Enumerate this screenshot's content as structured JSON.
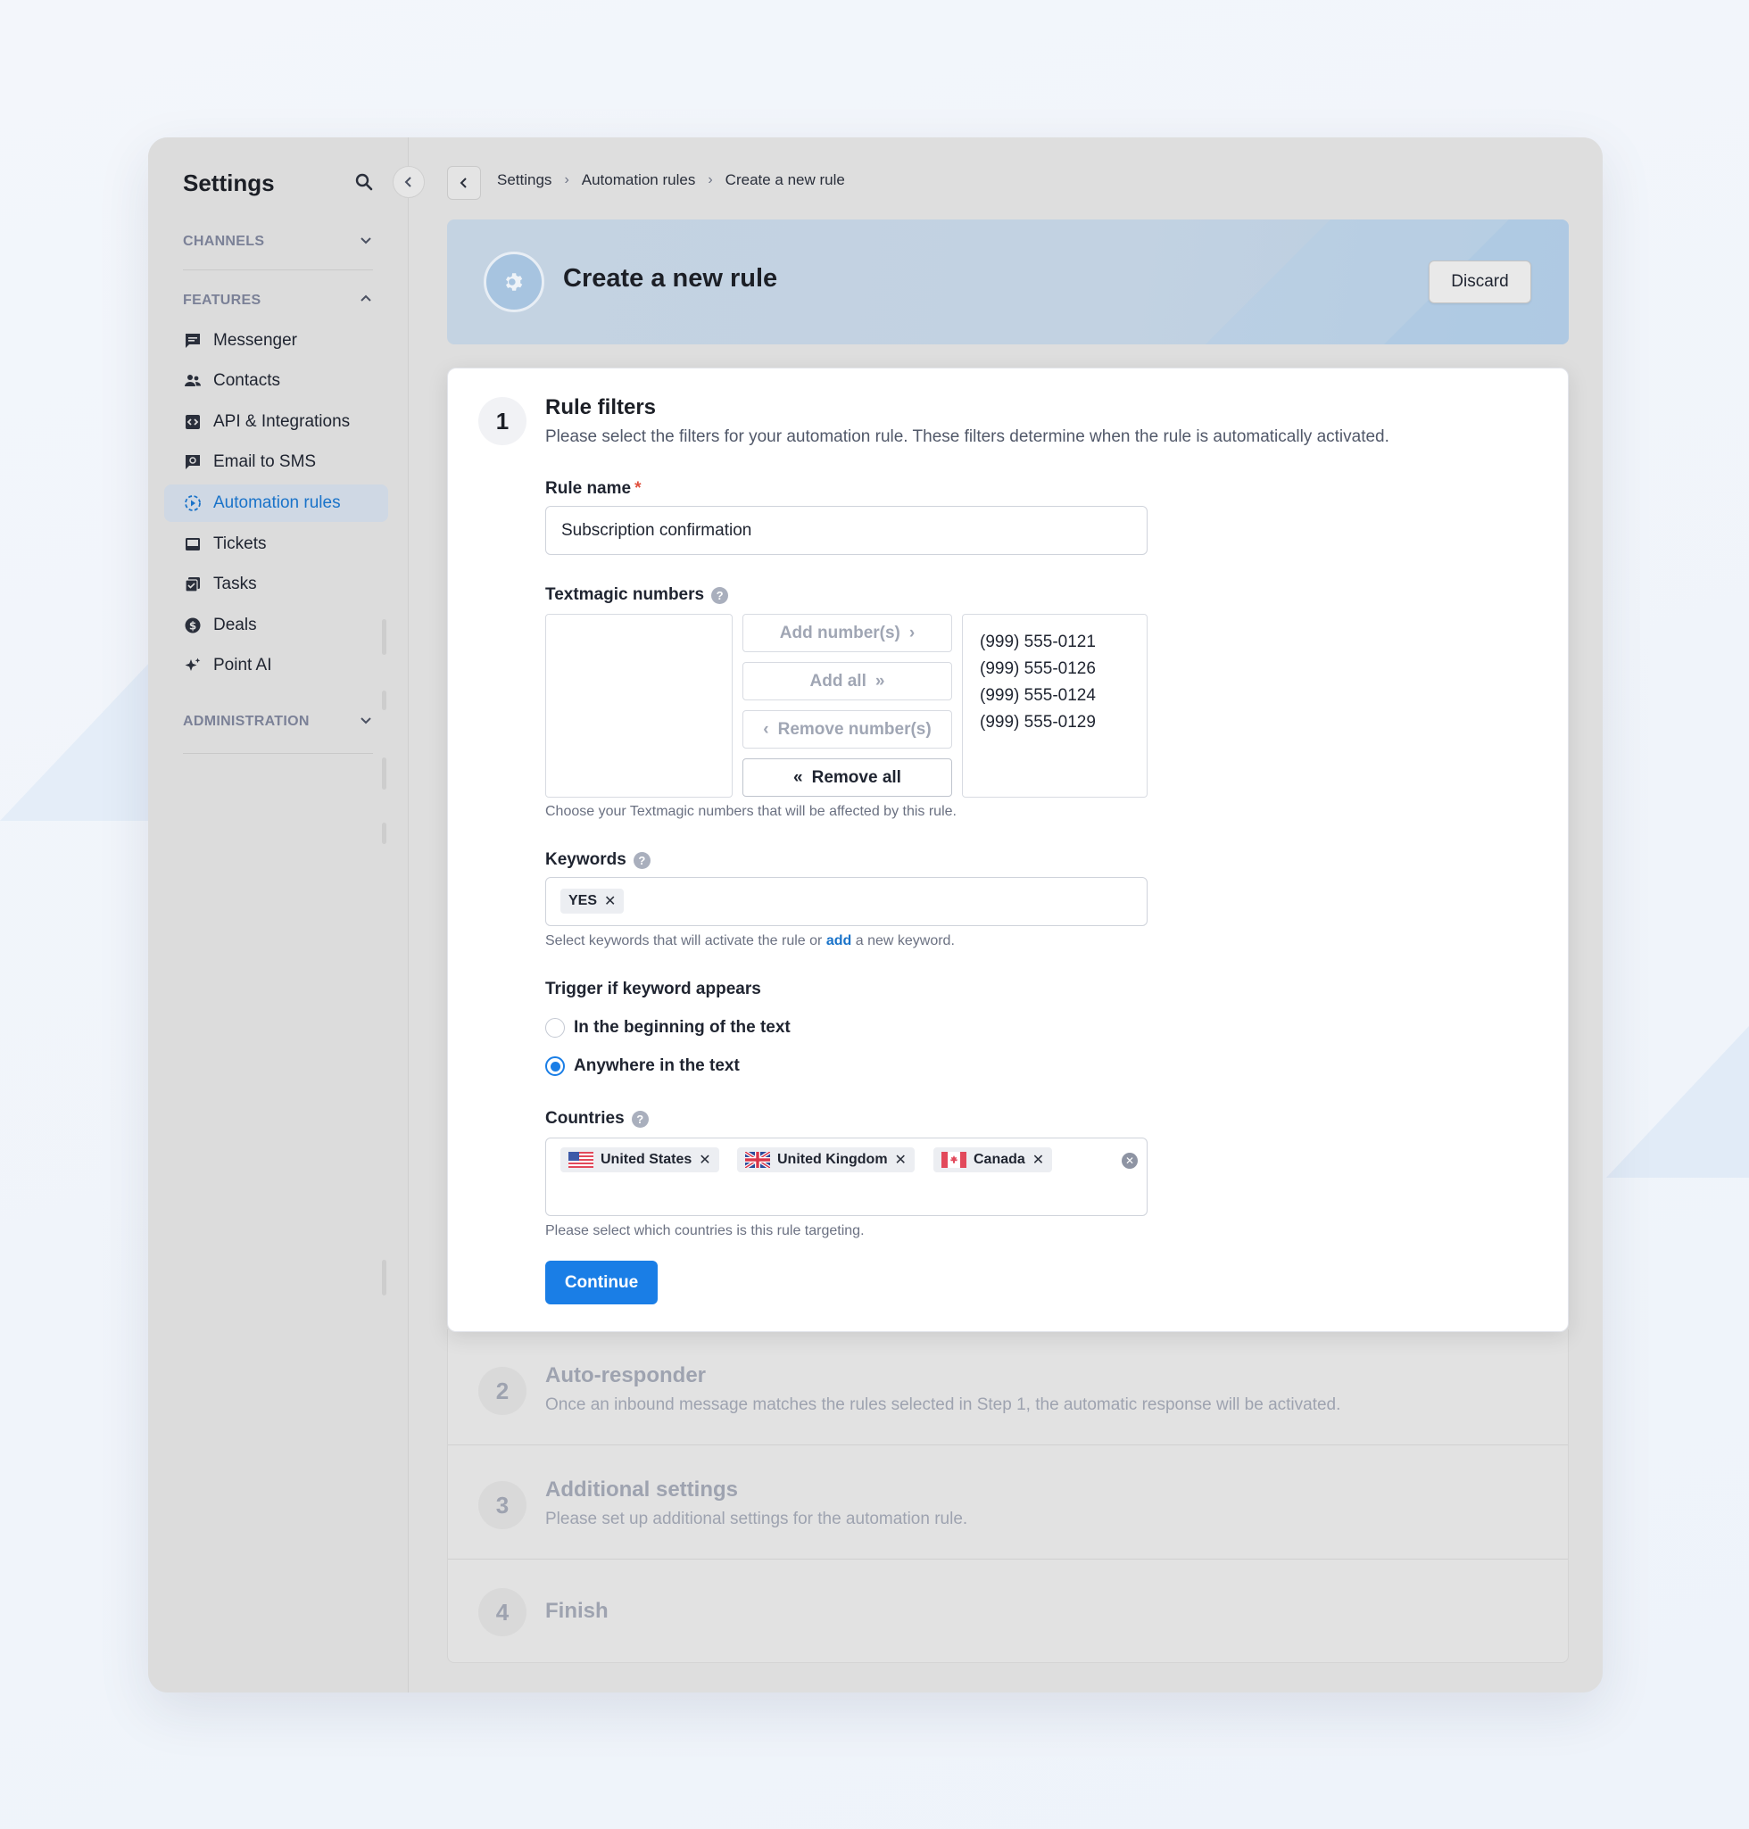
{
  "sidebar": {
    "title": "Settings",
    "sections": {
      "channels": "CHANNELS",
      "features": "FEATURES",
      "administration": "ADMINISTRATION"
    },
    "items": [
      {
        "label": "Messenger",
        "icon": "chat-icon"
      },
      {
        "label": "Contacts",
        "icon": "people-icon"
      },
      {
        "label": "API & Integrations",
        "icon": "code-icon"
      },
      {
        "label": "Email to SMS",
        "icon": "email-sms-icon"
      },
      {
        "label": "Automation rules",
        "icon": "automation-icon",
        "active": true
      },
      {
        "label": "Tickets",
        "icon": "inbox-icon"
      },
      {
        "label": "Tasks",
        "icon": "tasks-icon"
      },
      {
        "label": "Deals",
        "icon": "dollar-icon"
      },
      {
        "label": "Point AI",
        "icon": "sparkle-icon"
      }
    ]
  },
  "breadcrumb": [
    "Settings",
    "Automation rules",
    "Create a new rule"
  ],
  "header": {
    "title": "Create a new rule",
    "discard_label": "Discard"
  },
  "step1": {
    "number": "1",
    "title": "Rule filters",
    "description": "Please select the filters for your automation rule. These filters determine when the rule is automatically activated.",
    "rule_name_label": "Rule name",
    "rule_name_required": "*",
    "rule_name_value": "Subscription confirmation",
    "numbers_label": "Textmagic numbers",
    "numbers_hint": "Choose your Textmagic numbers that will be affected by this rule.",
    "buttons": {
      "add_numbers": "Add number(s)",
      "add_all": "Add all",
      "remove_numbers": "Remove number(s)",
      "remove_all": "Remove all"
    },
    "selected_numbers": [
      "(999) 555-0121",
      "(999) 555-0126",
      "(999) 555-0124",
      "(999) 555-0129"
    ],
    "keywords_label": "Keywords",
    "keywords": [
      "YES"
    ],
    "keywords_hint_before": "Select keywords that will activate the rule or",
    "keywords_hint_link": "add",
    "keywords_hint_after": "a new keyword.",
    "trigger_label": "Trigger if keyword appears",
    "trigger_options": [
      {
        "label": "In the beginning of the text",
        "checked": false
      },
      {
        "label": "Anywhere in the text",
        "checked": true
      }
    ],
    "countries_label": "Countries",
    "countries": [
      "United States",
      "United Kingdom",
      "Canada"
    ],
    "countries_hint": "Please select which countries is this rule targeting.",
    "continue_label": "Continue"
  },
  "step2": {
    "number": "2",
    "title": "Auto-responder",
    "description": "Once an inbound message matches the rules selected in Step 1, the automatic response will be activated."
  },
  "step3": {
    "number": "3",
    "title": "Additional settings",
    "description": "Please set up additional settings for the automation rule."
  },
  "step4": {
    "number": "4",
    "title": "Finish"
  },
  "colors": {
    "accent": "#1a7ee6",
    "link": "#1a73c9",
    "required": "#e0513e"
  }
}
